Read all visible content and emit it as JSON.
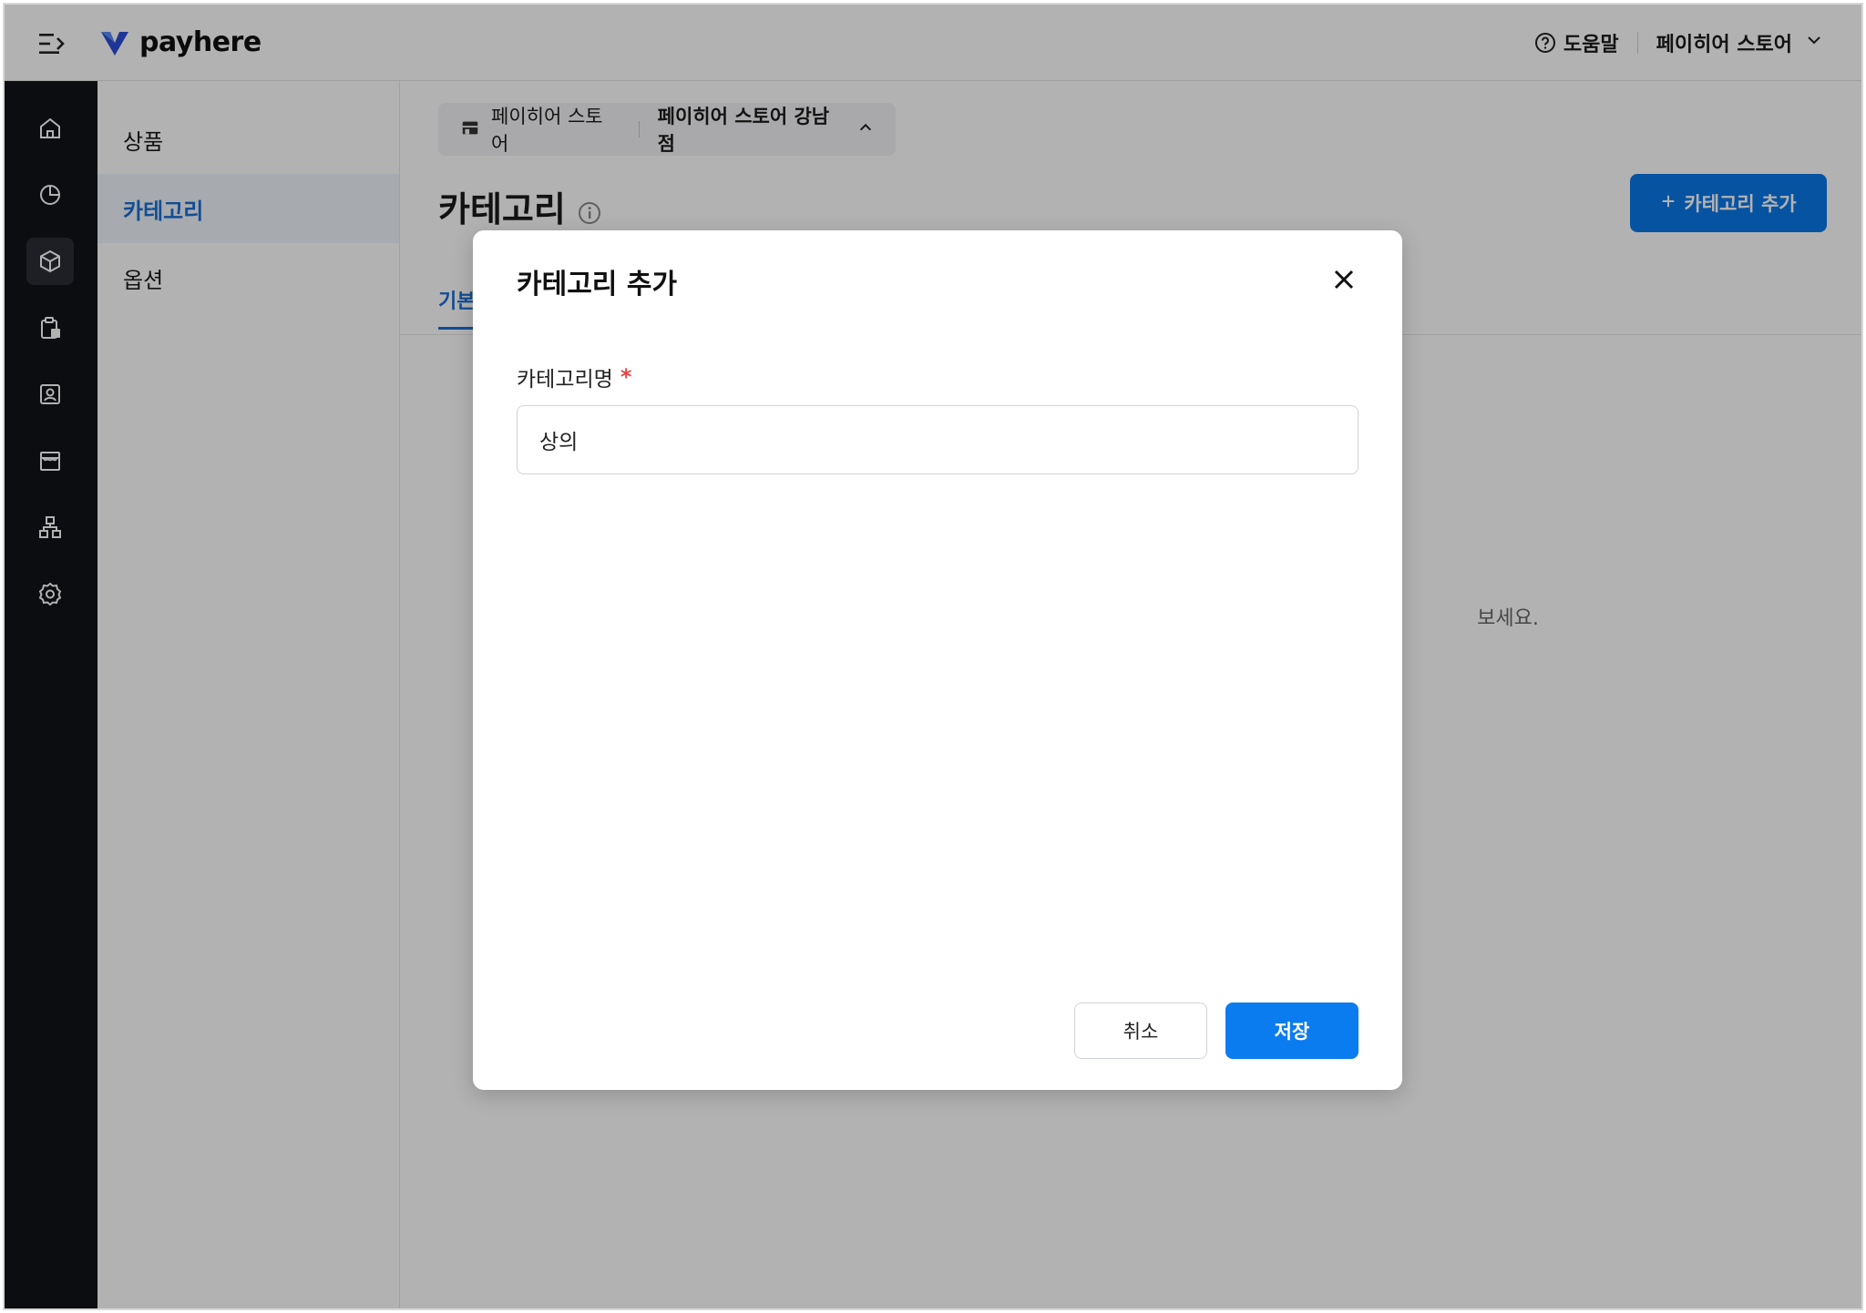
{
  "header": {
    "logo_text": "payhere",
    "help_label": "도움말",
    "store_menu_label": "페이히어 스토어"
  },
  "rail": {
    "items": [
      {
        "icon": "home-icon"
      },
      {
        "icon": "pie-chart-icon"
      },
      {
        "icon": "box-icon",
        "active": true
      },
      {
        "icon": "clipboard-icon"
      },
      {
        "icon": "contact-icon"
      },
      {
        "icon": "store-icon"
      },
      {
        "icon": "org-chart-icon"
      },
      {
        "icon": "gear-icon"
      }
    ]
  },
  "subnav": {
    "items": [
      {
        "label": "상품"
      },
      {
        "label": "카테고리",
        "active": true
      },
      {
        "label": "옵션"
      }
    ]
  },
  "main": {
    "store_chip": {
      "brand": "페이히어 스토어",
      "branch": "페이히어 스토어 강남점"
    },
    "page_title": "카테고리",
    "add_button_label": "카테고리 추가",
    "tab_basic": "기본",
    "empty_text_visible": "보세요."
  },
  "modal": {
    "title": "카테고리 추가",
    "field_label": "카테고리명",
    "required_mark": "*",
    "field_value": "상의",
    "cancel_label": "취소",
    "save_label": "저장"
  },
  "colors": {
    "accent": "#0a7cf0",
    "rail_bg": "#121318",
    "required": "#e84545"
  }
}
